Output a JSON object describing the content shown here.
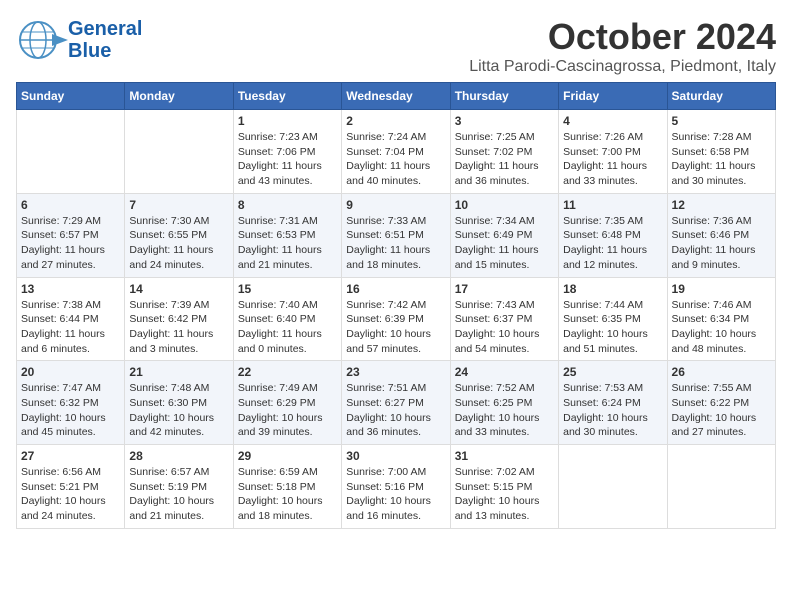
{
  "brand": {
    "name_part1": "General",
    "name_part2": "Blue"
  },
  "title": "October 2024",
  "subtitle": "Litta Parodi-Cascinagrossa, Piedmont, Italy",
  "days_of_week": [
    "Sunday",
    "Monday",
    "Tuesday",
    "Wednesday",
    "Thursday",
    "Friday",
    "Saturday"
  ],
  "weeks": [
    [
      {
        "day": "",
        "content": ""
      },
      {
        "day": "",
        "content": ""
      },
      {
        "day": "1",
        "content": "Sunrise: 7:23 AM\nSunset: 7:06 PM\nDaylight: 11 hours\nand 43 minutes."
      },
      {
        "day": "2",
        "content": "Sunrise: 7:24 AM\nSunset: 7:04 PM\nDaylight: 11 hours\nand 40 minutes."
      },
      {
        "day": "3",
        "content": "Sunrise: 7:25 AM\nSunset: 7:02 PM\nDaylight: 11 hours\nand 36 minutes."
      },
      {
        "day": "4",
        "content": "Sunrise: 7:26 AM\nSunset: 7:00 PM\nDaylight: 11 hours\nand 33 minutes."
      },
      {
        "day": "5",
        "content": "Sunrise: 7:28 AM\nSunset: 6:58 PM\nDaylight: 11 hours\nand 30 minutes."
      }
    ],
    [
      {
        "day": "6",
        "content": "Sunrise: 7:29 AM\nSunset: 6:57 PM\nDaylight: 11 hours\nand 27 minutes."
      },
      {
        "day": "7",
        "content": "Sunrise: 7:30 AM\nSunset: 6:55 PM\nDaylight: 11 hours\nand 24 minutes."
      },
      {
        "day": "8",
        "content": "Sunrise: 7:31 AM\nSunset: 6:53 PM\nDaylight: 11 hours\nand 21 minutes."
      },
      {
        "day": "9",
        "content": "Sunrise: 7:33 AM\nSunset: 6:51 PM\nDaylight: 11 hours\nand 18 minutes."
      },
      {
        "day": "10",
        "content": "Sunrise: 7:34 AM\nSunset: 6:49 PM\nDaylight: 11 hours\nand 15 minutes."
      },
      {
        "day": "11",
        "content": "Sunrise: 7:35 AM\nSunset: 6:48 PM\nDaylight: 11 hours\nand 12 minutes."
      },
      {
        "day": "12",
        "content": "Sunrise: 7:36 AM\nSunset: 6:46 PM\nDaylight: 11 hours\nand 9 minutes."
      }
    ],
    [
      {
        "day": "13",
        "content": "Sunrise: 7:38 AM\nSunset: 6:44 PM\nDaylight: 11 hours\nand 6 minutes."
      },
      {
        "day": "14",
        "content": "Sunrise: 7:39 AM\nSunset: 6:42 PM\nDaylight: 11 hours\nand 3 minutes."
      },
      {
        "day": "15",
        "content": "Sunrise: 7:40 AM\nSunset: 6:40 PM\nDaylight: 11 hours\nand 0 minutes."
      },
      {
        "day": "16",
        "content": "Sunrise: 7:42 AM\nSunset: 6:39 PM\nDaylight: 10 hours\nand 57 minutes."
      },
      {
        "day": "17",
        "content": "Sunrise: 7:43 AM\nSunset: 6:37 PM\nDaylight: 10 hours\nand 54 minutes."
      },
      {
        "day": "18",
        "content": "Sunrise: 7:44 AM\nSunset: 6:35 PM\nDaylight: 10 hours\nand 51 minutes."
      },
      {
        "day": "19",
        "content": "Sunrise: 7:46 AM\nSunset: 6:34 PM\nDaylight: 10 hours\nand 48 minutes."
      }
    ],
    [
      {
        "day": "20",
        "content": "Sunrise: 7:47 AM\nSunset: 6:32 PM\nDaylight: 10 hours\nand 45 minutes."
      },
      {
        "day": "21",
        "content": "Sunrise: 7:48 AM\nSunset: 6:30 PM\nDaylight: 10 hours\nand 42 minutes."
      },
      {
        "day": "22",
        "content": "Sunrise: 7:49 AM\nSunset: 6:29 PM\nDaylight: 10 hours\nand 39 minutes."
      },
      {
        "day": "23",
        "content": "Sunrise: 7:51 AM\nSunset: 6:27 PM\nDaylight: 10 hours\nand 36 minutes."
      },
      {
        "day": "24",
        "content": "Sunrise: 7:52 AM\nSunset: 6:25 PM\nDaylight: 10 hours\nand 33 minutes."
      },
      {
        "day": "25",
        "content": "Sunrise: 7:53 AM\nSunset: 6:24 PM\nDaylight: 10 hours\nand 30 minutes."
      },
      {
        "day": "26",
        "content": "Sunrise: 7:55 AM\nSunset: 6:22 PM\nDaylight: 10 hours\nand 27 minutes."
      }
    ],
    [
      {
        "day": "27",
        "content": "Sunrise: 6:56 AM\nSunset: 5:21 PM\nDaylight: 10 hours\nand 24 minutes."
      },
      {
        "day": "28",
        "content": "Sunrise: 6:57 AM\nSunset: 5:19 PM\nDaylight: 10 hours\nand 21 minutes."
      },
      {
        "day": "29",
        "content": "Sunrise: 6:59 AM\nSunset: 5:18 PM\nDaylight: 10 hours\nand 18 minutes."
      },
      {
        "day": "30",
        "content": "Sunrise: 7:00 AM\nSunset: 5:16 PM\nDaylight: 10 hours\nand 16 minutes."
      },
      {
        "day": "31",
        "content": "Sunrise: 7:02 AM\nSunset: 5:15 PM\nDaylight: 10 hours\nand 13 minutes."
      },
      {
        "day": "",
        "content": ""
      },
      {
        "day": "",
        "content": ""
      }
    ]
  ]
}
